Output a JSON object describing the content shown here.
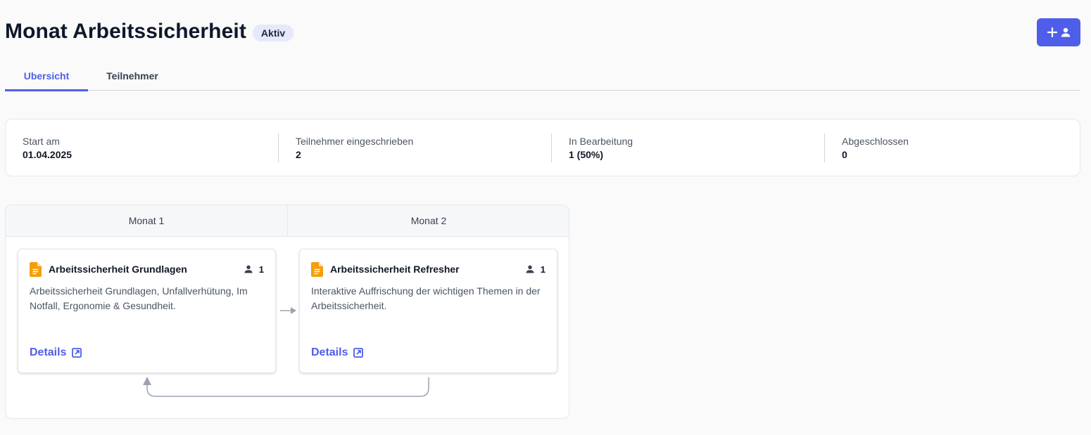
{
  "header": {
    "title": "Monat Arbeitssicherheit",
    "status": "Aktiv",
    "add_button_icons": [
      "plus-icon",
      "person-icon"
    ]
  },
  "tabs": [
    {
      "label": "Ubersicht",
      "active": true
    },
    {
      "label": "Teilnehmer",
      "active": false
    }
  ],
  "stats": [
    {
      "label": "Start am",
      "value": "01.04.2025"
    },
    {
      "label": "Teilnehmer eingeschrieben",
      "value": "2"
    },
    {
      "label": "In Bearbeitung",
      "value": "1 (50%)"
    },
    {
      "label": "Abgeschlossen",
      "value": "0"
    }
  ],
  "flow": {
    "months": [
      "Monat 1",
      "Monat 2"
    ],
    "modules": [
      {
        "title": "Arbeitssicherheit Grundlagen",
        "participants": "1",
        "description": "Arbeitssicherheit Grundlagen, Unfallverhütung, Im Notfall, Ergonomie & Gesundheit.",
        "details_label": "Details"
      },
      {
        "title": "Arbeitssicherheit Refresher",
        "participants": "1",
        "description": "Interaktive Auffrischung der wichtigen Themen in der Arbeitssicherheit.",
        "details_label": "Details"
      }
    ]
  },
  "colors": {
    "accent": "#4f5ee8",
    "document_icon": "#f59e0b",
    "connector": "#9ca3af"
  }
}
